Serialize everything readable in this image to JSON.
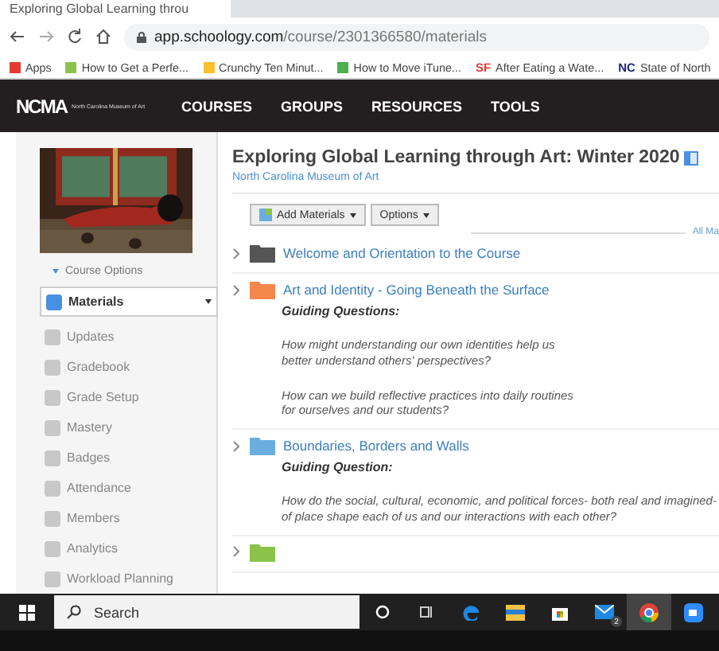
{
  "browser": {
    "tab_title": "Exploring Global Learning throu",
    "url_host": "app.schoology.com",
    "url_path": "/course/2301366580/materials",
    "bookmarks": [
      {
        "label": "Apps",
        "color": "#e53935"
      },
      {
        "label": "How to Get a Perfe...",
        "color": "#8bc34a"
      },
      {
        "label": "Crunchy Ten Minut...",
        "color": "#fbc02d"
      },
      {
        "label": "How to Move iTune...",
        "color": "#4caf50"
      },
      {
        "label": "After Eating a Wate...",
        "color": "#e53935",
        "mark": "SF"
      },
      {
        "label": "State of North",
        "color": "#1a237e",
        "mark": "NC"
      }
    ]
  },
  "nav": {
    "logo": "NCMA",
    "logo_caption": "North Carolina Museum of Art",
    "items": [
      "COURSES",
      "GROUPS",
      "RESOURCES",
      "TOOLS"
    ]
  },
  "sidebar": {
    "course_options": "Course Options",
    "items": [
      {
        "label": "Materials",
        "selected": true
      },
      {
        "label": "Updates",
        "selected": false
      },
      {
        "label": "Gradebook",
        "selected": false
      },
      {
        "label": "Grade Setup",
        "selected": false
      },
      {
        "label": "Mastery",
        "selected": false
      },
      {
        "label": "Badges",
        "selected": false
      },
      {
        "label": "Attendance",
        "selected": false
      },
      {
        "label": "Members",
        "selected": false
      },
      {
        "label": "Analytics",
        "selected": false
      },
      {
        "label": "Workload Planning",
        "selected": false
      }
    ]
  },
  "course": {
    "title": "Exploring Global Learning through Art: Winter 2020",
    "subtitle": "North Carolina Museum of Art",
    "buttons": [
      "Add Materials",
      "Options"
    ],
    "all_materials": "All Ma",
    "folders": [
      {
        "title": "Welcome and Orientation to the Course",
        "color": "#555555"
      },
      {
        "title": "Art and Identity - Going Beneath the Surface",
        "color": "#f4874b",
        "heading": "Guiding Questions:",
        "paragraphs": [
          "How might understanding our own identities help us better understand others' perspectives?",
          "How can we build reflective practices into daily routines for ourselves and our students?"
        ]
      },
      {
        "title": "Boundaries, Borders and Walls",
        "color": "#6aaee0",
        "heading": "Guiding Question:",
        "paragraphs": [
          "How do the social, cultural, economic, and political forces- both real and imagined- of place shape each of us and our interactions with each other?"
        ]
      },
      {
        "color": "#8bc34a"
      }
    ]
  },
  "taskbar": {
    "search_placeholder": "Search",
    "mail_badge": "2"
  }
}
